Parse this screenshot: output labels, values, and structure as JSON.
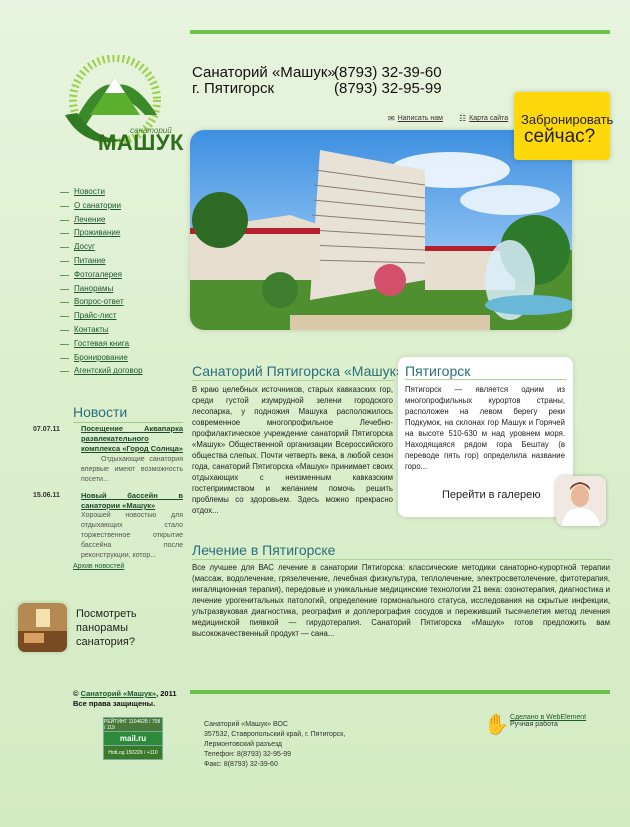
{
  "header": {
    "name": "Санаторий «Машук»",
    "city": "г. Пятигорск",
    "phone1": "(8793) 32-39-60",
    "phone2": "(8793) 32-95-99"
  },
  "logo": {
    "small": "санаторий",
    "brand": "МАШУК"
  },
  "util": {
    "write": "Написать нам",
    "sitemap": "Карта сайта"
  },
  "booking": {
    "line1": "Забронировать",
    "line2": "сейчас?"
  },
  "nav": [
    "Новости",
    "О санатории",
    "Лечение",
    "Проживание",
    "Досуг",
    "Питание",
    "Фотогалерея",
    "Панорамы",
    "Вопрос-ответ",
    "Прайс-лист",
    "Контакты",
    "Гостевая книга",
    "Бронирование",
    "Агентский договор"
  ],
  "news": {
    "title": "Новости",
    "items": [
      {
        "date": "07.07.11",
        "headline": "Посещение Аквапарка развлекательного комплекса «Город Солнца»",
        "body": "Отдыхающие санатория впервые имеют возможность посети..."
      },
      {
        "date": "15.06.11",
        "headline": "Новый бассейн в санатории «Машук»",
        "body": "Хорошей новостью для отдыхающих стало торжественное открытие бассейна после реконструкции, котор..."
      }
    ],
    "archive": "Архив новостей"
  },
  "about": {
    "title": "Санаторий Пятигорска «Машук»",
    "text": "В краю целебных источников, старых кавказских гор, среди густой изумрудной зелени городского лесопарка, у подножия Машука расположилось современное многопрофильное Лечебно-профилактическое учреждение санаторий Пятигорска «Машук» Общественной организации Всероссийского общества слепых. Почти четверть века, в любой сезон года, санаторий Пятигорска «Машук» принимает своих отдыхающих с неизменным кавказским гостеприимством и желанием помочь решить проблемы со здоровьем. Здесь можно прекрасно отдох..."
  },
  "city_card": {
    "title": "Пятигорск",
    "text": "Пятигорск — является одним из многопрофильных курортов страны, расположен на левом берегу реки Подкумок, на склонах гор Машук и Горячей на высоте 510-630 м над уровнем моря. Находящаяся рядом гора Бештау (в переводе пять гор) определила название горо...",
    "gallery": "Перейти в галерею"
  },
  "treatment": {
    "title": "Лечение в Пятигорске",
    "text": "Все лучшее для ВАС лечение в санатории Пятигорска: классические методики санаторно-курортной терапии (массаж, водолечение, грязелечение, лечебная физкультура, теплолечение, электросветолечение, фитотерапия, ингаляционная терапия), передовые и уникальные медицинские технологии 21 века: озонотерапия, диагностика и лечение урогенитальных патологий, определение гормонального статуса, исследования на скрытые инфекции, ультразвуковая диагностика, реография и доплерография сосудов и переживший тысячелетия метод лечения медицинской пиявкой — гирудотерапия.  Санаторий Пятигорска «Машук» готов предложить вам высококачественный продукт — сана..."
  },
  "panorama": {
    "line1": "Посмотреть",
    "line2": "панорамы",
    "line3": "санатория?"
  },
  "footer": {
    "copy_prefix": "©",
    "copy_link": "Санаторий «Машук»",
    "copy_year": ", 2011",
    "rights": "Все права защищены.",
    "address": [
      "Санаторий «Машук» ВОС",
      "357532, Ставропольский край, г. Пятигорск,",
      "Лермонтовский разъезд",
      "Телефон: 8(8793) 32-95-99",
      "Факс: 8(8793) 32-39-60"
    ],
    "dev_link": "Сделано в WebElement",
    "dev_note": "Ручная работа",
    "counters": [
      "РЕЙТИНГ 1104628 / 708 / 119",
      "mail.ru",
      "HotLog 150229 / +110"
    ]
  },
  "colors": {
    "accent": "#6cc24a",
    "title": "#2b6e7a",
    "booking": "#ffd80c"
  }
}
